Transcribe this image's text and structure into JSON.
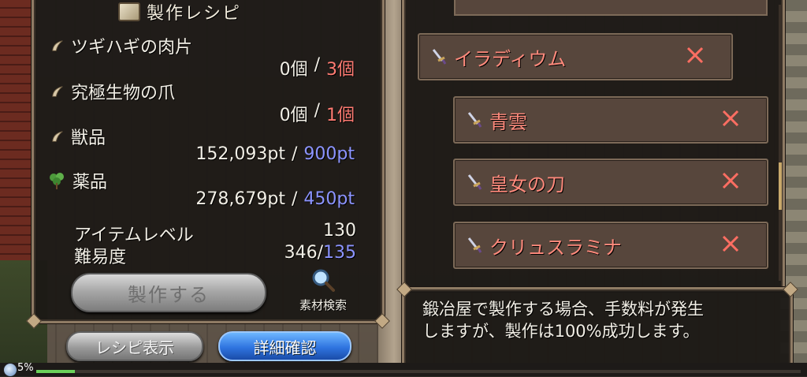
{
  "title": "製作レシピ",
  "materials": [
    {
      "name": "ツギハギの肉片",
      "icon": "claw-icon",
      "have": "0個",
      "sep": "/",
      "need": "3個",
      "need_color": "red"
    },
    {
      "name": "究極生物の爪",
      "icon": "claw-icon",
      "have": "0個",
      "sep": "/",
      "need": "1個",
      "need_color": "red"
    },
    {
      "name": "獣品",
      "icon": "claw-icon",
      "have": "152,093pt",
      "sep": "/",
      "need": "900pt",
      "need_color": "blue"
    },
    {
      "name": "薬品",
      "icon": "herb-icon",
      "have": "278,679pt",
      "sep": "/",
      "need": "450pt",
      "need_color": "blue"
    }
  ],
  "item_level": {
    "label": "アイテムレベル",
    "value": "130"
  },
  "difficulty": {
    "label": "難易度",
    "value": "346/",
    "value_accent": "135"
  },
  "craft_button": "製作する",
  "search_label": "素材検索",
  "recipe_button": "レシピ表示",
  "detail_button": "詳細確認",
  "list_items": [
    {
      "name": "イラディウム",
      "icon": "sword-icon"
    },
    {
      "name": "青雲",
      "icon": "sword-icon"
    },
    {
      "name": "皇女の刀",
      "icon": "sword-icon"
    },
    {
      "name": "クリュスラミナ",
      "icon": "sword-icon"
    }
  ],
  "description": {
    "line1": "鍛冶屋で製作する場合、手数料が発生",
    "line2": "しますが、製作は100%成功します。"
  },
  "exp_percent": "5%",
  "exp_fraction": 0.05,
  "colors": {
    "red": "#ff7b72",
    "blue": "#8c94ff",
    "item_text": "#ff8a7c",
    "detail_button": "#2f74e0"
  }
}
